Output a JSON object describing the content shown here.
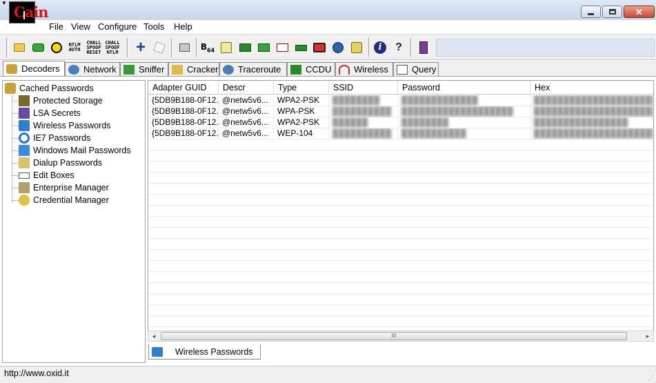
{
  "menu": [
    "File",
    "View",
    "Configure",
    "Tools",
    "Help"
  ],
  "toolbar": {
    "ntlm_auth": "NTLM AUTH",
    "chall_spoof_reset": "CHALL SPOOF RESET",
    "chall_spoof_ntlm": "CHALL SPOOF NTLM",
    "b64": "B",
    "b64_sub": "64",
    "help_symbol": "?",
    "info_symbol": "i",
    "add_symbol": "+"
  },
  "tabs": [
    "Decoders",
    "Network",
    "Sniffer",
    "Cracker",
    "Traceroute",
    "CCDU",
    "Wireless",
    "Query"
  ],
  "tree": {
    "root": "Cached Passwords",
    "items": [
      "Protected Storage",
      "LSA Secrets",
      "Wireless Passwords",
      "IE7 Passwords",
      "Windows Mail Passwords",
      "Dialup Passwords",
      "Edit Boxes",
      "Enterprise Manager",
      "Credential Manager"
    ]
  },
  "table": {
    "columns": [
      "Adapter GUID",
      "Descr",
      "Type",
      "SSID",
      "Password",
      "Hex"
    ],
    "rows": [
      [
        "{5DB9B188-0F12...",
        "@netw5v6...",
        "WPA2-PSK",
        "████████",
        "█████████████",
        "████████████████████████"
      ],
      [
        "{5DB9B188-0F12...",
        "@netw5v6...",
        "WPA-PSK",
        "██████████",
        "███████████████████",
        "████████████████████████"
      ],
      [
        "{5DB9B188-0F12...",
        "@netw5v6...",
        "WPA2-PSK",
        "██████",
        "████████",
        "████████████████"
      ],
      [
        "{5DB9B188-0F12...",
        "@netw5v6...",
        "WEP-104",
        "██████████",
        "███████████",
        "████████████████████████"
      ]
    ]
  },
  "scrollbar_grip": "III",
  "bottom_tab": "Wireless Passwords",
  "status": "http://www.oxid.it",
  "colors": {
    "title_bar": "#c5d6ea",
    "logo_bg": "#000000",
    "logo_fg": "#d4151c",
    "accent": "#1b3fa0"
  }
}
